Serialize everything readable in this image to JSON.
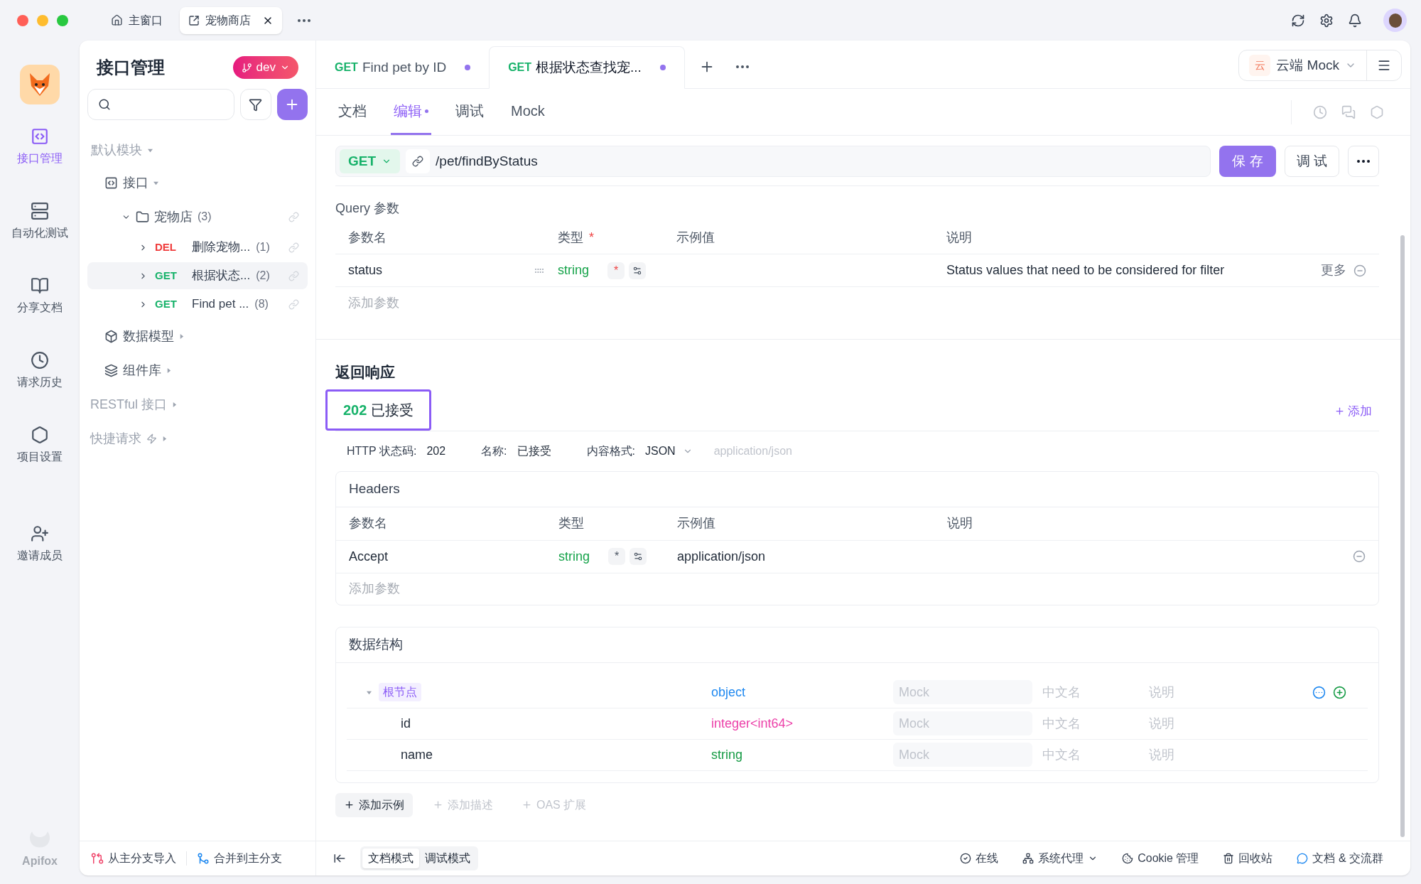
{
  "window_tabs": [
    {
      "label": "主窗口",
      "selected": false
    },
    {
      "label": "宠物商店",
      "selected": true
    }
  ],
  "rail": {
    "items": [
      {
        "kind": "api",
        "label": "接口管理",
        "selected": true
      },
      {
        "kind": "auto",
        "label": "自动化测试",
        "selected": false
      },
      {
        "kind": "docs",
        "label": "分享文档",
        "selected": false
      },
      {
        "kind": "history",
        "label": "请求历史",
        "selected": false
      },
      {
        "kind": "settings",
        "label": "项目设置",
        "selected": false
      }
    ],
    "invite": "邀请成员",
    "brand": "Apifox"
  },
  "tree": {
    "title": "接口管理",
    "branch": "dev",
    "module": "默认模块",
    "items": [
      {
        "kind": "interfaces",
        "label": "接口",
        "expanded": true,
        "children": [
          {
            "kind": "folder",
            "label": "宠物店",
            "count": "(3)",
            "expanded": true,
            "children": [
              {
                "kind": "endpoint",
                "method": "DEL",
                "color": "#ef3b3b",
                "label": "删除宠物...",
                "count": "(1)",
                "selected": false
              },
              {
                "kind": "endpoint",
                "method": "GET",
                "color": "#17b26a",
                "label": "根据状态...",
                "count": "(2)",
                "selected": true
              },
              {
                "kind": "endpoint",
                "method": "GET",
                "color": "#17b26a",
                "label": "Find pet ...",
                "count": "(8)",
                "selected": false
              }
            ]
          }
        ]
      },
      {
        "kind": "models",
        "label": "数据模型",
        "expanded": false
      },
      {
        "kind": "library",
        "label": "组件库",
        "expanded": false
      },
      {
        "kind": "category",
        "label": "RESTful 接口",
        "expanded": false
      },
      {
        "kind": "quick",
        "label": "快捷请求",
        "expanded": false
      }
    ],
    "footer": [
      "从主分支导入",
      "合并到主分支"
    ]
  },
  "tabs": [
    {
      "method": "GET",
      "title": "Find pet by ID",
      "selected": false,
      "modified": true
    },
    {
      "method": "GET",
      "title": "根据状态查找宠...",
      "selected": true,
      "modified": true
    }
  ],
  "env": {
    "badge": "云",
    "label": "云端 Mock"
  },
  "subtabs": [
    {
      "label": "文档",
      "selected": false,
      "modified": false
    },
    {
      "label": "编辑",
      "selected": true,
      "modified": true
    },
    {
      "label": "调试",
      "selected": false,
      "modified": false
    },
    {
      "label": "Mock",
      "selected": false,
      "modified": false
    }
  ],
  "url": {
    "method": "GET",
    "path": "/pet/findByStatus",
    "save": "保 存",
    "debug": "调 试"
  },
  "query": {
    "title": "Query 参数",
    "columns": [
      {
        "label": "参数名"
      },
      {
        "label": "类型",
        "mark": "*"
      },
      {
        "label": "示例值"
      },
      {
        "label": "说明"
      }
    ],
    "rows": [
      {
        "name": "status",
        "type": "string",
        "required": true,
        "star": "*",
        "example": "",
        "desc": "Status values that need to be considered for filter",
        "more": "更多"
      }
    ],
    "add": "添加参数"
  },
  "response": {
    "title": "返回响应",
    "tabs": [
      {
        "code": "202",
        "label": "已接受",
        "selected": true
      }
    ],
    "add": "添加",
    "info": [
      {
        "label": "HTTP 状态码:",
        "value": "202",
        "dropdown": false
      },
      {
        "label": "名称:",
        "value": "已接受",
        "dropdown": false
      },
      {
        "label": "内容格式:",
        "value": "JSON",
        "dropdown": true
      }
    ],
    "content_type": "application/json",
    "headers": {
      "title": "Headers",
      "columns": [
        {
          "label": "参数名"
        },
        {
          "label": "类型"
        },
        {
          "label": "示例值"
        },
        {
          "label": "说明"
        }
      ],
      "rows": [
        {
          "name": "Accept",
          "type": "string",
          "required": false,
          "star": "*",
          "example": "application/json",
          "desc": "",
          "more": ""
        }
      ],
      "add": "添加参数"
    },
    "schema": {
      "title": "数据结构",
      "rows": [
        {
          "name": "根节点",
          "root": true,
          "expanded": true,
          "type": "object",
          "color": "#1e88f0",
          "mock": "Mock",
          "cn": "中文名",
          "desc": "说明",
          "children": [
            {
              "name": "id",
              "root": false,
              "type": "integer<int64>",
              "color": "#ec3fa8",
              "mock": "Mock",
              "cn": "中文名",
              "desc": "说明"
            },
            {
              "name": "name",
              "root": false,
              "type": "string",
              "color": "#169b45",
              "mock": "Mock",
              "cn": "中文名",
              "desc": "说明"
            }
          ]
        }
      ]
    },
    "actions": [
      {
        "label": "添加示例",
        "enabled": true
      },
      {
        "label": "添加描述",
        "enabled": false
      },
      {
        "label": "OAS 扩展",
        "enabled": false
      }
    ]
  },
  "modes": [
    {
      "label": "文档模式",
      "selected": true
    },
    {
      "label": "调试模式",
      "selected": false
    }
  ],
  "status": [
    {
      "kind": "online",
      "label": "在线"
    },
    {
      "kind": "proxy",
      "label": "系统代理"
    },
    {
      "kind": "cookie",
      "label": "Cookie 管理"
    },
    {
      "kind": "trash",
      "label": "回收站"
    },
    {
      "kind": "chat",
      "label": "文档 & 交流群"
    }
  ]
}
